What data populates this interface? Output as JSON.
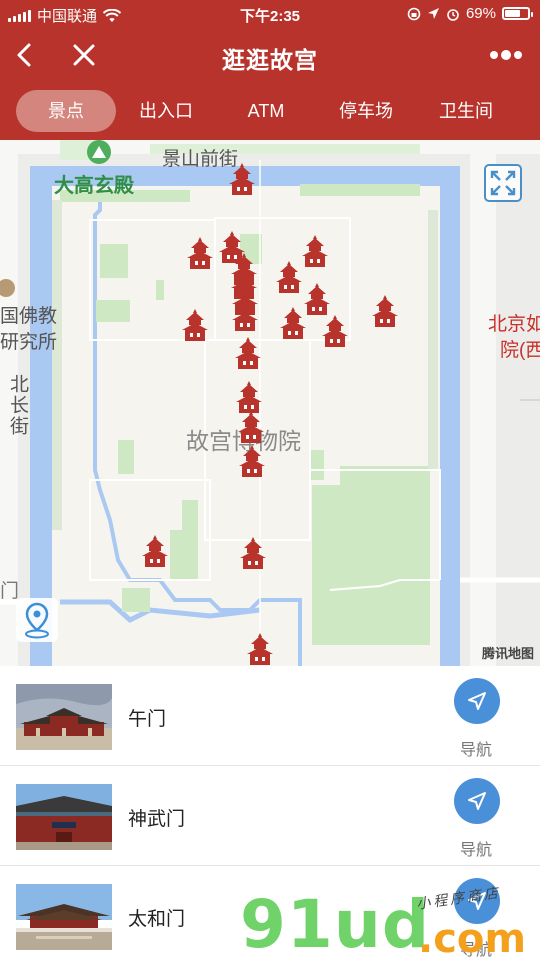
{
  "status_bar": {
    "carrier": "中国联通",
    "time": "下午2:35",
    "battery_percent": "69%",
    "battery_level": 0.69
  },
  "nav": {
    "title": "逛逛故宫"
  },
  "tabs": [
    {
      "label": "景点",
      "active": true
    },
    {
      "label": "出入口",
      "active": false
    },
    {
      "label": "ATM",
      "active": false
    },
    {
      "label": "停车场",
      "active": false
    },
    {
      "label": "卫生间",
      "active": false
    }
  ],
  "map": {
    "labels": {
      "road_north": "景山前街",
      "park": "大高玄殿",
      "center": "故宫博物院",
      "west_1": "国佛教",
      "west_2": "研究所",
      "west_road": "北长街",
      "east_1": "北京如",
      "east_2": "院(西",
      "gate": "门"
    },
    "logo": "腾讯地图",
    "colors": {
      "moat": "#a9c8f2",
      "wall": "#f6f4ef",
      "green": "#cfe8c4",
      "marker": "#b8332b"
    }
  },
  "list": [
    {
      "name": "午门",
      "action": "导航"
    },
    {
      "name": "神武门",
      "action": "导航"
    },
    {
      "name": "太和门",
      "action": "导航"
    }
  ],
  "watermark": {
    "main": "91ud",
    "com": ".com",
    "sub": "小程序商店"
  }
}
